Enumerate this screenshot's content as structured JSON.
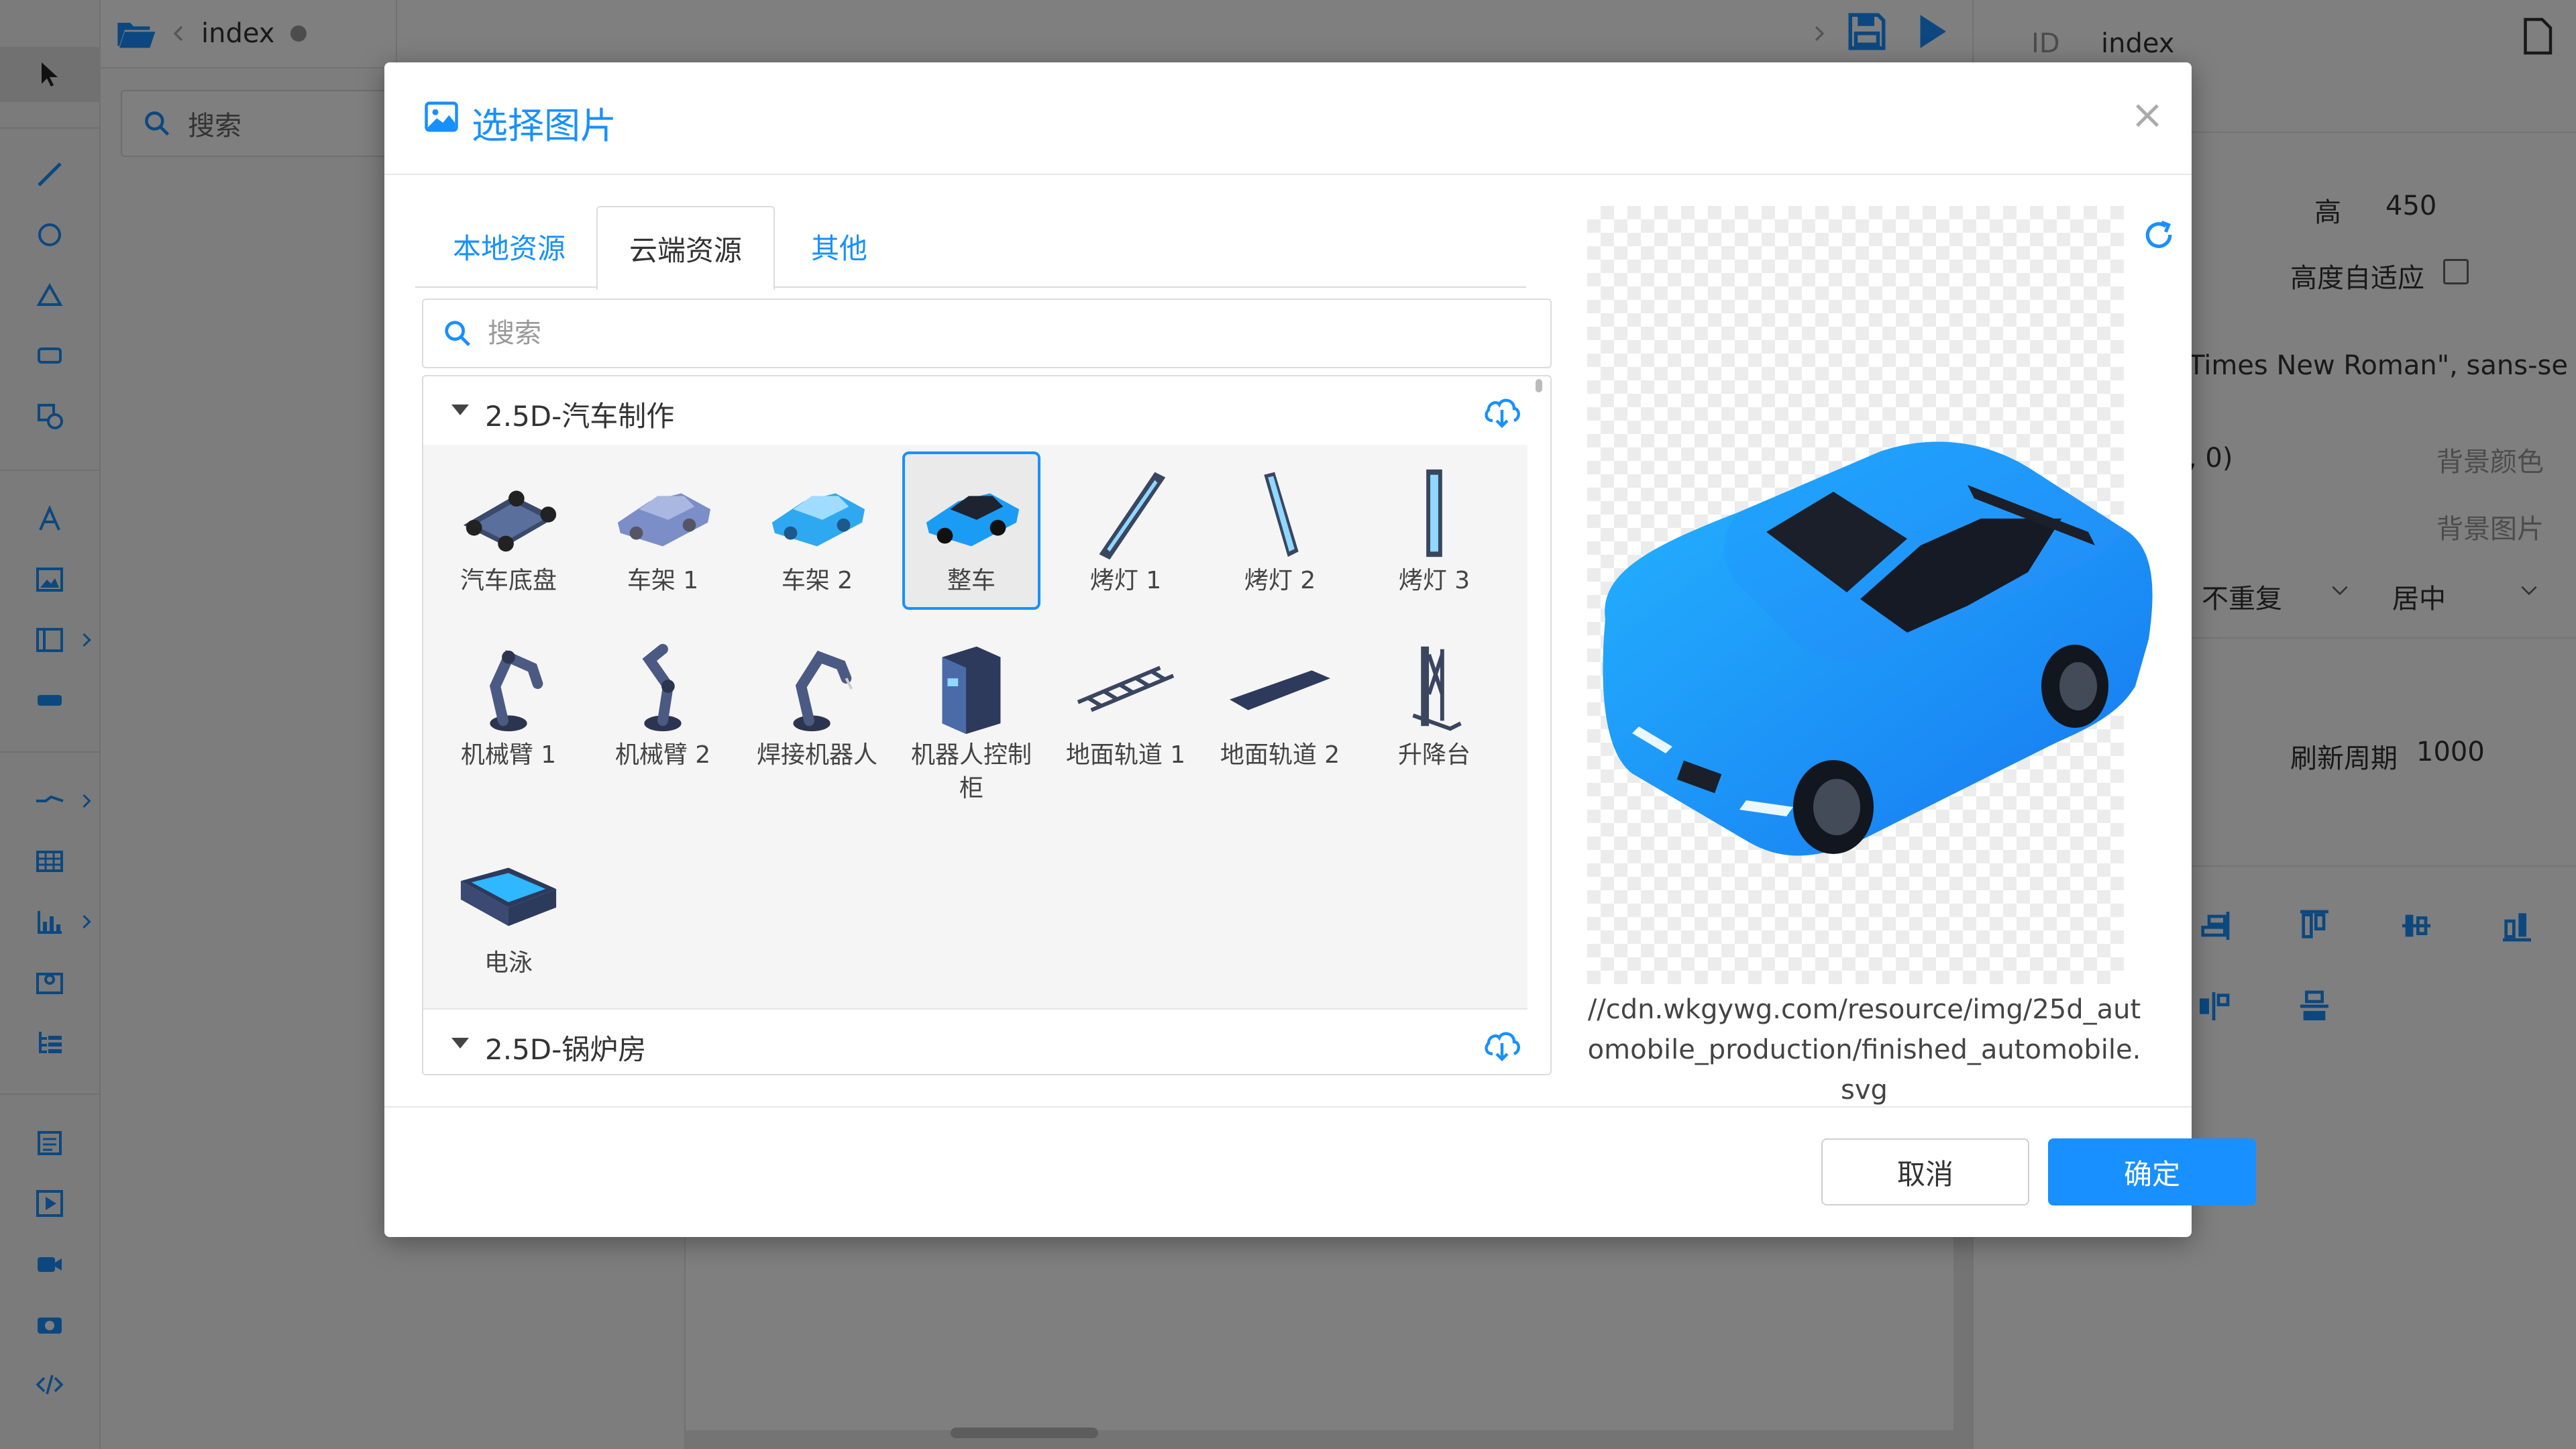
{
  "editor": {
    "tab_title": "index",
    "search_placeholder": "搜索"
  },
  "right_panel": {
    "id_label": "ID",
    "id_value": "index",
    "height_label": "高",
    "height_value": "450",
    "auto_height_label": "高度自适应",
    "font_value": "Times New Roman\", sans-se",
    "color_fragment": ", 0)",
    "bg_color_label": "背景颜色",
    "bg_image_label": "背景图片",
    "repeat_value": "不重复",
    "position_value": "居中",
    "refresh_label": "刷新周期",
    "refresh_value": "1000"
  },
  "dialog": {
    "title": "选择图片",
    "close_label": "×",
    "tabs": [
      {
        "label": "本地资源"
      },
      {
        "label": "云端资源"
      },
      {
        "label": "其他"
      }
    ],
    "active_tab": "云端资源",
    "search_placeholder": "搜索",
    "groups": [
      {
        "name": "2.5D-汽车制作",
        "items": [
          {
            "label": "汽车底盘"
          },
          {
            "label": "车架 1"
          },
          {
            "label": "车架 2"
          },
          {
            "label": "整车"
          },
          {
            "label": "烤灯 1"
          },
          {
            "label": "烤灯 2"
          },
          {
            "label": "烤灯 3"
          },
          {
            "label": "机械臂 1"
          },
          {
            "label": "机械臂 2"
          },
          {
            "label": "焊接机器人"
          },
          {
            "label": "机器人控制柜"
          },
          {
            "label": "地面轨道 1"
          },
          {
            "label": "地面轨道 2"
          },
          {
            "label": "升降台"
          },
          {
            "label": "电泳"
          }
        ],
        "selected": "整车"
      },
      {
        "name": "2.5D-锅炉房"
      }
    ],
    "preview_url": "//cdn.wkgywg.com/resource/img/25d_automobile_production/finished_automobile.svg",
    "cancel_label": "取消",
    "ok_label": "确定"
  },
  "colors": {
    "accent": "#1890ff",
    "overlay": "rgba(0,0,0,0.5)"
  }
}
